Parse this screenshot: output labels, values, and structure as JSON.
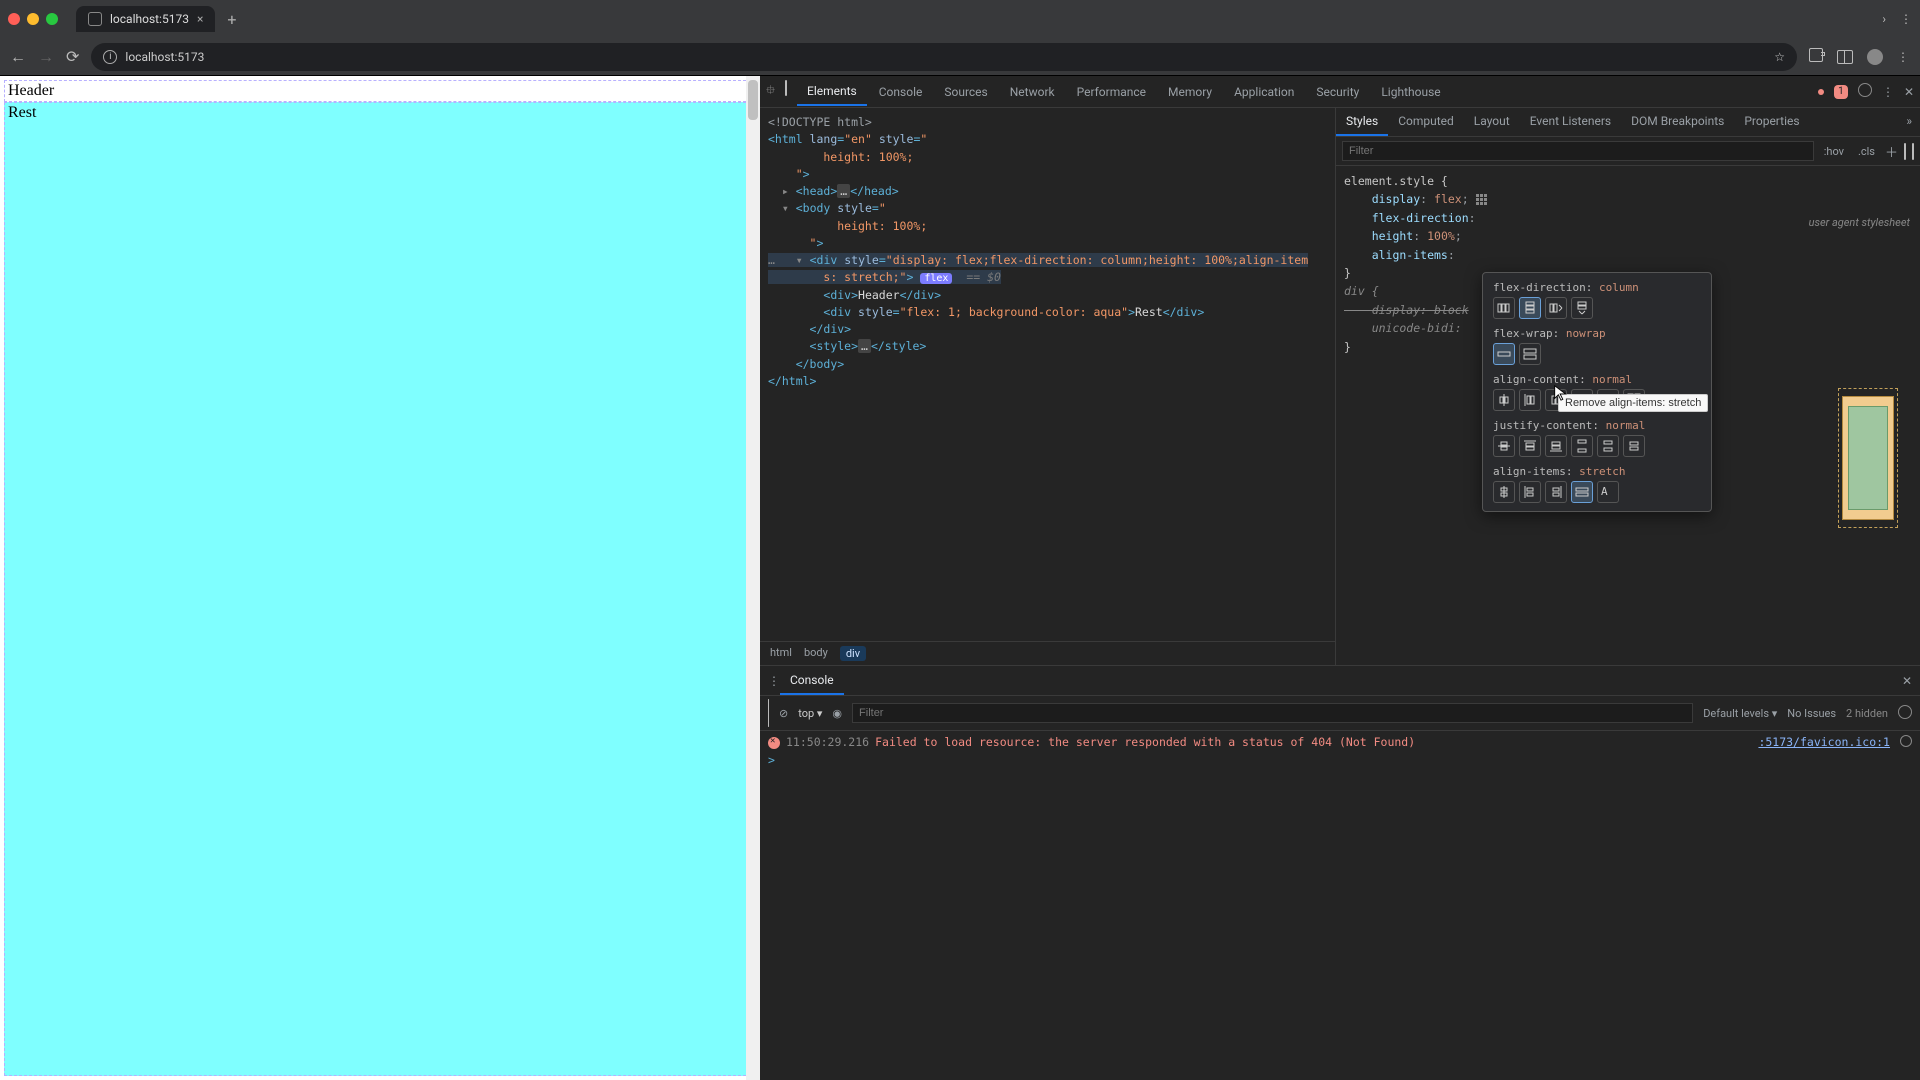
{
  "titlebar": {
    "tab_title": "localhost:5173",
    "close_glyph": "×",
    "newtab_glyph": "+",
    "win_chevron": "›",
    "win_menu": "⋮"
  },
  "toolbar": {
    "back_glyph": "←",
    "forward_glyph": "→",
    "reload_glyph": "⟳",
    "url_display": "localhost:5173",
    "star_glyph": "☆",
    "menu_glyph": "⋮"
  },
  "page": {
    "header_text": "Header",
    "rest_text": "Rest"
  },
  "devtools": {
    "tabs": [
      "Elements",
      "Console",
      "Sources",
      "Network",
      "Performance",
      "Memory",
      "Application",
      "Security",
      "Lighthouse"
    ],
    "active_tab": "Elements",
    "err_count": "1",
    "gear_glyph": "⚙",
    "more_glyph": "⋮",
    "close_glyph": "✕"
  },
  "dom": {
    "doctype": "<!DOCTYPE html>",
    "html_open": "<html lang=\"en\" style=\"\n        height: 100%;\n    \">",
    "head": "<head>…</head>",
    "body_open": "<body style=\"\n          height: 100%;\n      \">",
    "row_ellipsis": "…",
    "div_main_1": "<div style=\"display: flex;flex-direction: column;height: 100%;align-item",
    "div_main_2": "s: stretch;\">",
    "flex_pill": "flex",
    "dollar0": "== $0",
    "div_header": "<div>Header</div>",
    "div_rest": "<div style=\"flex: 1; background-color: aqua\">Rest</div>",
    "div_close": "</div>",
    "style_tag": "<style>…</style>",
    "body_close": "</body>",
    "html_close": "</html>"
  },
  "breadcrumbs": [
    "html",
    "body",
    "div"
  ],
  "styles_tabs": [
    "Styles",
    "Computed",
    "Layout",
    "Event Listeners",
    "DOM Breakpoints",
    "Properties"
  ],
  "styles": {
    "filter_placeholder": "Filter",
    "hov": ":hov",
    "cls": ".cls"
  },
  "css": {
    "selector": "element.style {",
    "p1": "    display: flex;",
    "p2": "    flex-direction:",
    "p2_cut": "column;",
    "p3": "    height: 100%;",
    "p4": "    align-items:",
    "close1": "}",
    "div_sel": "div {",
    "p5": "    display: block",
    "p6": "    unicode-bidi:",
    "close2": "}",
    "ua_label": "user agent stylesheet"
  },
  "flex_popup": {
    "rows": [
      {
        "label": "flex-direction",
        "value": "column"
      },
      {
        "label": "flex-wrap",
        "value": "nowrap"
      },
      {
        "label": "align-content",
        "value": "normal"
      },
      {
        "label": "justify-content",
        "value": "normal"
      },
      {
        "label": "align-items",
        "value": "stretch"
      }
    ],
    "tooltip": "Remove align-items: stretch"
  },
  "drawer": {
    "tab": "Console",
    "menu": "⋮",
    "close": "✕",
    "context": "top",
    "filter_placeholder": "Filter",
    "levels": "Default levels",
    "issues": "No Issues",
    "hidden": "2 hidden",
    "timestamp": "11:50:29.216",
    "message": "Failed to load resource: the server responded with a status of 404 (Not Found)",
    "source": ":5173/favicon.ico:1",
    "prompt": ">"
  }
}
